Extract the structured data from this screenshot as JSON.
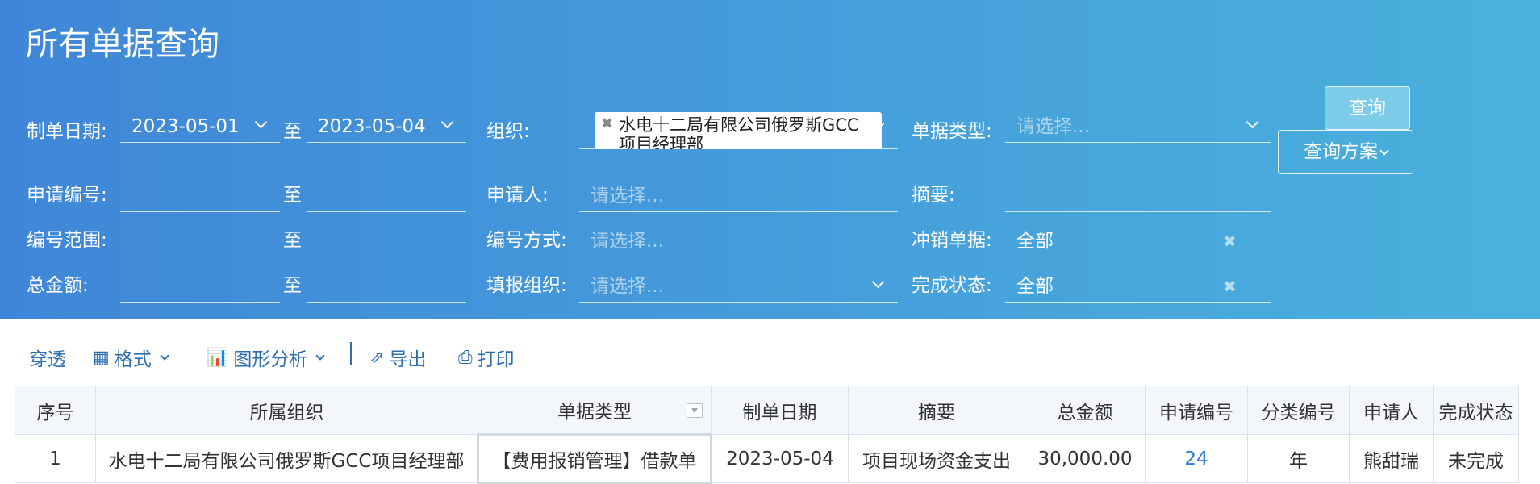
{
  "page": {
    "title": "所有单据查询"
  },
  "filters": {
    "date_label": "制单日期:",
    "date_from": "2023-05-01",
    "to": "至",
    "date_to": "2023-05-04",
    "org_label": "组织:",
    "org_value": "水电十二局有限公司俄罗斯GCC项目经理部",
    "doctype_label": "单据类型:",
    "doctype_placeholder": "请选择...",
    "appno_label": "申请编号:",
    "applicant_label": "申请人:",
    "applicant_placeholder": "请选择...",
    "summary_label": "摘要:",
    "numrange_label": "编号范围:",
    "nummethod_label": "编号方式:",
    "nummethod_placeholder": "请选择...",
    "writeoff_label": "冲销单据:",
    "writeoff_value": "全部",
    "amount_label": "总金额:",
    "fillorg_label": "填报组织:",
    "fillorg_placeholder": "请选择...",
    "status_label": "完成状态:",
    "status_value": "全部",
    "query_button": "查询",
    "plan_button": "查询方案"
  },
  "toolbar": {
    "drill": "穿透",
    "format": "格式",
    "chart": "图形分析",
    "export": "导出",
    "print": "打印"
  },
  "table": {
    "columns": [
      "序号",
      "所属组织",
      "单据类型",
      "制单日期",
      "摘要",
      "总金额",
      "申请编号",
      "分类编号",
      "申请人",
      "完成状态"
    ],
    "rows": [
      [
        "1",
        "水电十二局有限公司俄罗斯GCC项目经理部",
        "【费用报销管理】借款单",
        "2023-05-04",
        "项目现场资金支出",
        "30,000.00",
        "24",
        "年",
        "熊甜瑞",
        "未完成"
      ]
    ]
  },
  "colors": {
    "header_start": "#3f86d8",
    "header_end": "#4ab1dc",
    "link": "#2f7fd0"
  }
}
